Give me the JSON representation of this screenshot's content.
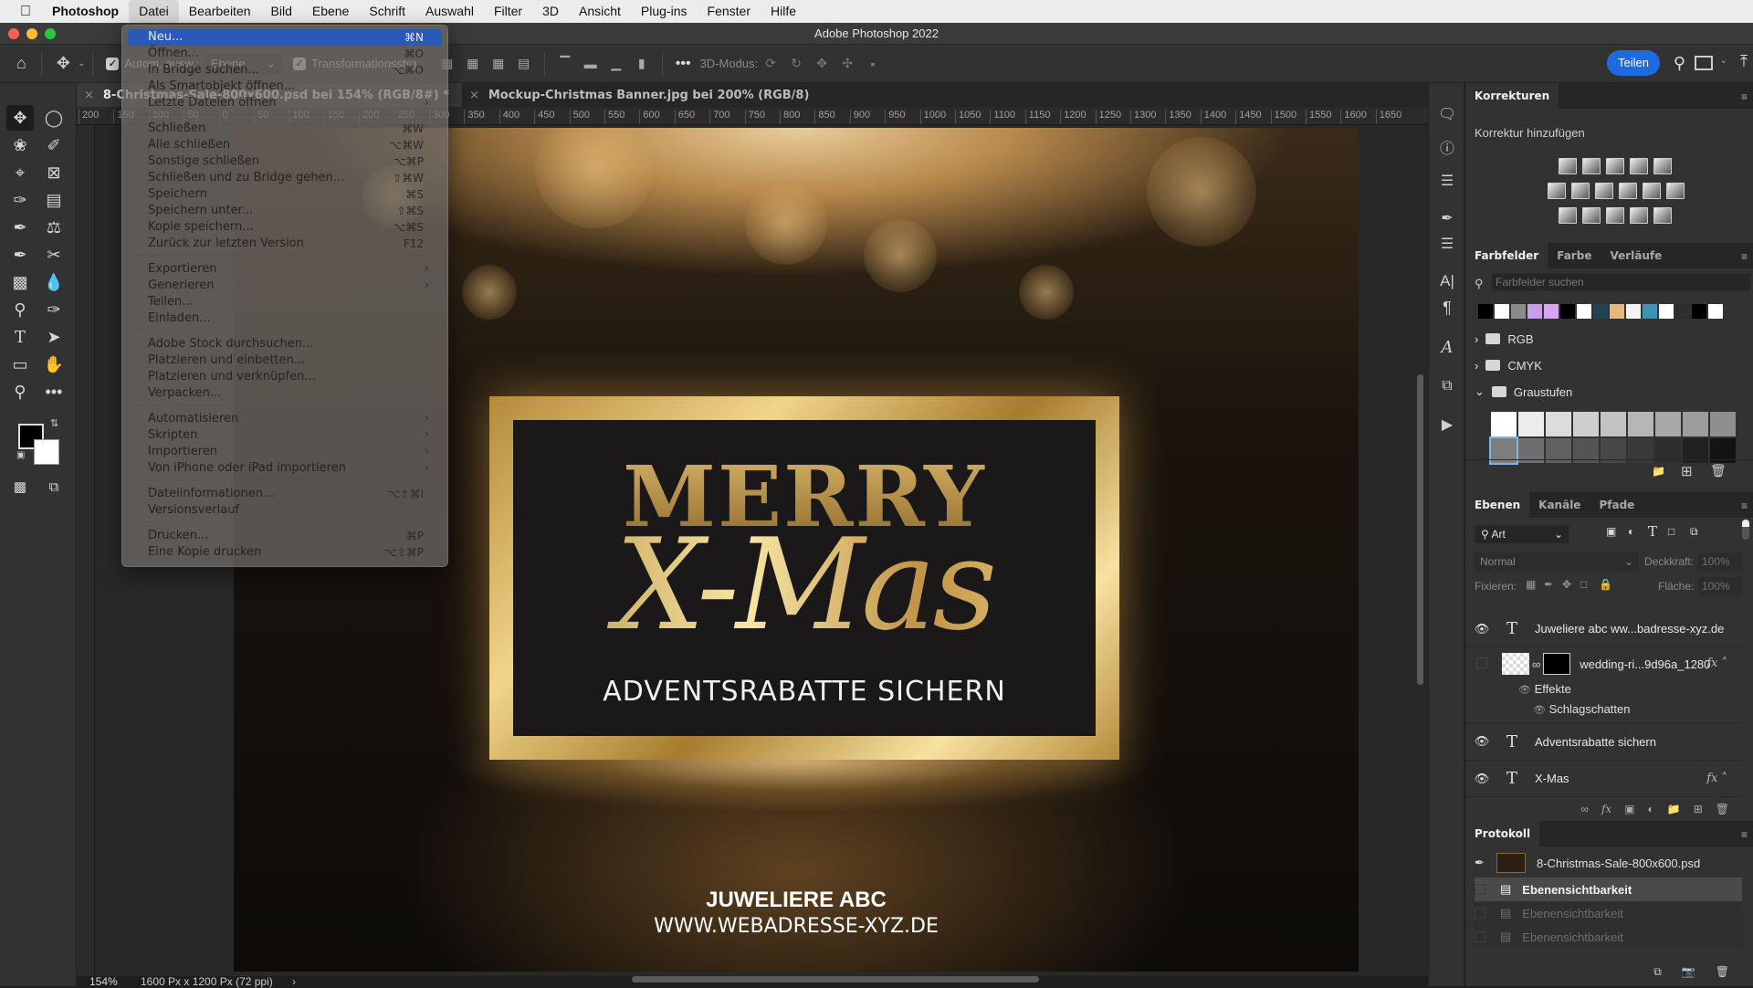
{
  "menubar": {
    "apple": "",
    "app": "Photoshop",
    "items": [
      "Datei",
      "Bearbeiten",
      "Bild",
      "Ebene",
      "Schrift",
      "Auswahl",
      "Filter",
      "3D",
      "Ansicht",
      "Plug-ins",
      "Fenster",
      "Hilfe"
    ],
    "active": "Datei"
  },
  "window": {
    "title": "Adobe Photoshop 2022"
  },
  "options_bar": {
    "auto_select_label": "Autom. ausw.:",
    "auto_select_checked": true,
    "auto_select_target": "Ebene",
    "transform_label": "Transformationsstrg.",
    "transform_checked": true,
    "more": "•••",
    "mode_3d_label": "3D-Modus:",
    "share_label": "Teilen"
  },
  "tabs": [
    {
      "label": "8-Christmas-Sale-800x600.psd bei 154% (RGB/8#) *",
      "active": true
    },
    {
      "label": "Mockup-Christmas Banner.jpg bei 200% (RGB/8)",
      "active": false
    }
  ],
  "ruler": {
    "ticks": [
      "200",
      "150",
      "100",
      "50",
      "0",
      "50",
      "100",
      "150",
      "200",
      "250",
      "300",
      "350",
      "400",
      "450",
      "500",
      "550",
      "600",
      "650",
      "700",
      "750",
      "800",
      "850",
      "900",
      "950",
      "1000",
      "1050",
      "1100",
      "1150",
      "1200",
      "1250",
      "1300",
      "1350",
      "1400",
      "1450",
      "1500",
      "1550",
      "1600",
      "1650"
    ]
  },
  "file_menu": {
    "groups": [
      [
        {
          "label": "Neu...",
          "shortcut": "⌘N",
          "highlighted": true
        },
        {
          "label": "Öffnen...",
          "shortcut": "⌘O"
        },
        {
          "label": "In Bridge suchen...",
          "shortcut": "⌥⌘O"
        },
        {
          "label": "Als Smartobjekt öffnen..."
        },
        {
          "label": "Letzte Dateien öffnen",
          "submenu": true
        }
      ],
      [
        {
          "label": "Schließen",
          "shortcut": "⌘W"
        },
        {
          "label": "Alle schließen",
          "shortcut": "⌥⌘W"
        },
        {
          "label": "Sonstige schließen",
          "shortcut": "⌥⌘P"
        },
        {
          "label": "Schließen und zu Bridge gehen...",
          "shortcut": "⇧⌘W"
        },
        {
          "label": "Speichern",
          "shortcut": "⌘S"
        },
        {
          "label": "Speichern unter...",
          "shortcut": "⇧⌘S"
        },
        {
          "label": "Kopie speichern...",
          "shortcut": "⌥⌘S"
        },
        {
          "label": "Zurück zur letzten Version",
          "shortcut": "F12"
        }
      ],
      [
        {
          "label": "Exportieren",
          "submenu": true
        },
        {
          "label": "Generieren",
          "submenu": true
        },
        {
          "label": "Teilen..."
        },
        {
          "label": "Einladen..."
        }
      ],
      [
        {
          "label": "Adobe Stock durchsuchen..."
        },
        {
          "label": "Platzieren und einbetten..."
        },
        {
          "label": "Platzieren und verknüpfen..."
        },
        {
          "label": "Verpacken..."
        }
      ],
      [
        {
          "label": "Automatisieren",
          "submenu": true
        },
        {
          "label": "Skripten",
          "submenu": true
        },
        {
          "label": "Importieren",
          "submenu": true
        },
        {
          "label": "Von iPhone oder iPad importieren",
          "submenu": true
        }
      ],
      [
        {
          "label": "Dateiinformationen...",
          "shortcut": "⌥⇧⌘I"
        },
        {
          "label": "Versionsverlauf"
        }
      ],
      [
        {
          "label": "Drucken...",
          "shortcut": "⌘P"
        },
        {
          "label": "Eine Kopie drucken",
          "shortcut": "⌥⇧⌘P"
        }
      ]
    ]
  },
  "artwork": {
    "merry": "MERRY",
    "xmas": "X-Mas",
    "advent": "ADVENTSRABATTE SICHERN",
    "company": "JUWELIERE ABC",
    "web": "WWW.WEBADRESSE-XYZ.DE"
  },
  "status": {
    "zoom": "154%",
    "doc": "1600 Px x 1200 Px (72 ppi)",
    "arrow": "›"
  },
  "panels": {
    "korrekturen": {
      "tab": "Korrekturen",
      "subtitle": "Korrektur hinzufügen"
    },
    "swatches": {
      "tabs": [
        "Farbfelder",
        "Farbe",
        "Verläufe"
      ],
      "search_placeholder": "Farbfelder suchen",
      "recent": [
        "#000000",
        "#ffffff",
        "#8a8a8a",
        "#c99be8",
        "#d8a5f2",
        "#000000",
        "#ffffff",
        "#1e4650",
        "#e4b97e",
        "#f2f2f2",
        "#3c93b4",
        "#ffffff",
        "#2e2e2e",
        "#000000",
        "#ffffff"
      ],
      "folders": [
        {
          "name": "RGB",
          "expanded": false
        },
        {
          "name": "CMYK",
          "expanded": false
        },
        {
          "name": "Graustufen",
          "expanded": true
        }
      ],
      "grays": [
        "#ffffff",
        "#ececec",
        "#dcdcdc",
        "#cfcfcf",
        "#c3c3c3",
        "#b6b6b6",
        "#a9a9a9",
        "#9c9c9c",
        "#8f8f8f",
        "#7d7d7d",
        "#6e6e6e",
        "#616161",
        "#545454",
        "#474747",
        "#3a3a3a",
        "#2d2d2d",
        "#212121",
        "#141414"
      ]
    },
    "layers": {
      "tabs": [
        "Ebenen",
        "Kanäle",
        "Pfade"
      ],
      "filter": "Art",
      "blend_mode": "Normal",
      "opacity_label": "Deckkraft:",
      "opacity": "100%",
      "lock_label": "Fixieren:",
      "fill_label": "Fläche:",
      "fill": "100%",
      "items": [
        {
          "name": "Juweliere abc ww...badresse-xyz.de",
          "type": "text",
          "visible": true
        },
        {
          "name": "wedding-ri...9d96a_1280",
          "type": "smart",
          "visible": false,
          "fx": true
        },
        {
          "name": "Effekte",
          "type": "effects"
        },
        {
          "name": "Schlagschatten",
          "type": "effect"
        },
        {
          "name": "Adventsrabatte sichern",
          "type": "text",
          "visible": true
        },
        {
          "name": "X-Mas",
          "type": "text",
          "visible": true,
          "fx": true
        }
      ]
    },
    "history": {
      "tab": "Protokoll",
      "snapshot": "8-Christmas-Sale-800x600.psd",
      "items": [
        {
          "label": "Ebenensichtbarkeit",
          "active": true
        },
        {
          "label": "Ebenensichtbarkeit",
          "active": false
        },
        {
          "label": "Ebenensichtbarkeit",
          "active": false
        }
      ]
    }
  },
  "colors": {
    "accent": "#1c6be0",
    "menu_highlight": "#2a5ab9",
    "foreground": "#000000",
    "background": "#ffffff"
  }
}
